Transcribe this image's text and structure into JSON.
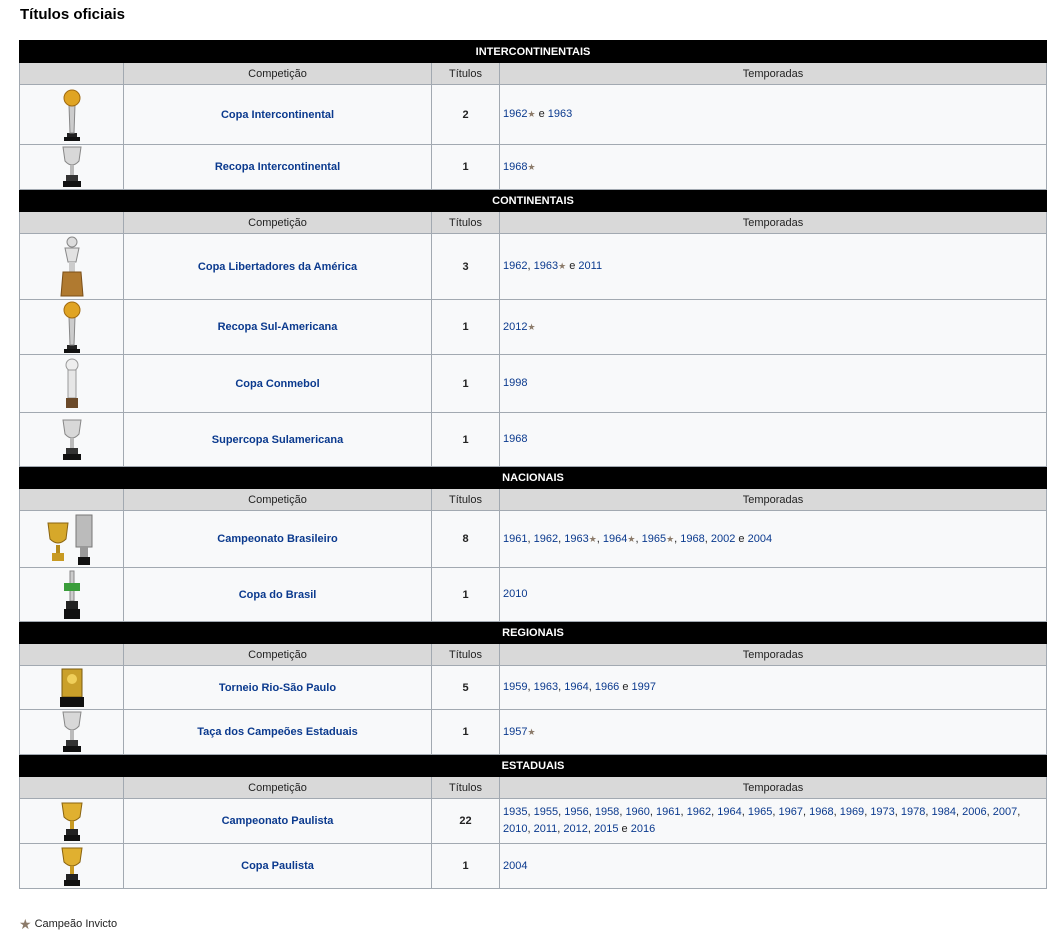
{
  "page_title": "Títulos oficiais",
  "columns": {
    "competition": "Competição",
    "titles": "Títulos",
    "seasons": "Temporadas"
  },
  "legend": {
    "text": "Campeão Invicto",
    "star_color": "#8c7b6a"
  },
  "colors": {
    "link": "#0b3a8e",
    "section_bg": "#000000",
    "header_bg": "#d9d9d9",
    "row_bg": "#f8f9fa"
  },
  "sections": [
    {
      "title": "INTERCONTINENTAIS",
      "rows": [
        {
          "name": "Copa Intercontinental",
          "titles": "2",
          "icon": "gold-ball-trophy-icon",
          "seasons": [
            {
              "y": "1962",
              "star": true,
              "sep": " e "
            },
            {
              "y": "1963",
              "star": false,
              "sep": ""
            }
          ]
        },
        {
          "name": "Recopa Intercontinental",
          "titles": "1",
          "icon": "silver-cup-trophy-icon",
          "seasons": [
            {
              "y": "1968",
              "star": true,
              "sep": ""
            }
          ]
        }
      ]
    },
    {
      "title": "CONTINENTAIS",
      "rows": [
        {
          "name": "Copa Libertadores da América",
          "titles": "3",
          "icon": "libertadores-trophy-icon",
          "seasons": [
            {
              "y": "1962",
              "star": false,
              "sep": ", "
            },
            {
              "y": "1963",
              "star": true,
              "sep": " e "
            },
            {
              "y": "2011",
              "star": false,
              "sep": ""
            }
          ]
        },
        {
          "name": "Recopa Sul-Americana",
          "titles": "1",
          "icon": "gold-ball-trophy-icon",
          "seasons": [
            {
              "y": "2012",
              "star": true,
              "sep": ""
            }
          ]
        },
        {
          "name": "Copa Conmebol",
          "titles": "1",
          "icon": "silver-pillar-trophy-icon",
          "seasons": [
            {
              "y": "1998",
              "star": false,
              "sep": ""
            }
          ]
        },
        {
          "name": "Supercopa Sulamericana",
          "titles": "1",
          "icon": "silver-cup-trophy-icon",
          "seasons": [
            {
              "y": "1968",
              "star": false,
              "sep": ""
            }
          ]
        }
      ]
    },
    {
      "title": "NACIONAIS",
      "rows": [
        {
          "name": "Campeonato Brasileiro",
          "titles": "8",
          "icon": "brasileiro-trophies-icon",
          "seasons": [
            {
              "y": "1961",
              "star": false,
              "sep": ", "
            },
            {
              "y": "1962",
              "star": false,
              "sep": ", "
            },
            {
              "y": "1963",
              "star": true,
              "sep": ", "
            },
            {
              "y": "1964",
              "star": true,
              "sep": ", "
            },
            {
              "y": "1965",
              "star": true,
              "sep": ", "
            },
            {
              "y": "1968",
              "star": false,
              "sep": ", "
            },
            {
              "y": "2002",
              "star": false,
              "sep": " e "
            },
            {
              "y": "2004",
              "star": false,
              "sep": ""
            }
          ]
        },
        {
          "name": "Copa do Brasil",
          "titles": "1",
          "icon": "copa-do-brasil-trophy-icon",
          "seasons": [
            {
              "y": "2010",
              "star": false,
              "sep": ""
            }
          ]
        }
      ]
    },
    {
      "title": "REGIONAIS",
      "rows": [
        {
          "name": "Torneio Rio-São Paulo",
          "titles": "5",
          "icon": "plaque-trophy-icon",
          "seasons": [
            {
              "y": "1959",
              "star": false,
              "sep": ", "
            },
            {
              "y": "1963",
              "star": false,
              "sep": ", "
            },
            {
              "y": "1964",
              "star": false,
              "sep": ", "
            },
            {
              "y": "1966",
              "star": false,
              "sep": " e "
            },
            {
              "y": "1997",
              "star": false,
              "sep": ""
            }
          ]
        },
        {
          "name": "Taça dos Campeões Estaduais",
          "titles": "1",
          "icon": "silver-cup-trophy-icon",
          "seasons": [
            {
              "y": "1957",
              "star": true,
              "sep": ""
            }
          ]
        }
      ]
    },
    {
      "title": "ESTADUAIS",
      "rows": [
        {
          "name": "Campeonato Paulista",
          "titles": "22",
          "icon": "gold-cup-trophy-icon",
          "seasons": [
            {
              "y": "1935",
              "star": false,
              "sep": ", "
            },
            {
              "y": "1955",
              "star": false,
              "sep": ", "
            },
            {
              "y": "1956",
              "star": false,
              "sep": ", "
            },
            {
              "y": "1958",
              "star": false,
              "sep": ", "
            },
            {
              "y": "1960",
              "star": false,
              "sep": ", "
            },
            {
              "y": "1961",
              "star": false,
              "sep": ", "
            },
            {
              "y": "1962",
              "star": false,
              "sep": ", "
            },
            {
              "y": "1964",
              "star": false,
              "sep": ", "
            },
            {
              "y": "1965",
              "star": false,
              "sep": ", "
            },
            {
              "y": "1967",
              "star": false,
              "sep": ", "
            },
            {
              "y": "1968",
              "star": false,
              "sep": ", "
            },
            {
              "y": "1969",
              "star": false,
              "sep": ", "
            },
            {
              "y": "1973",
              "star": false,
              "sep": ", "
            },
            {
              "y": "1978",
              "star": false,
              "sep": ", "
            },
            {
              "y": "1984",
              "star": false,
              "sep": ", "
            },
            {
              "y": "2006",
              "star": false,
              "sep": ", "
            },
            {
              "y": "2007",
              "star": false,
              "sep": ", "
            },
            {
              "y": "2010",
              "star": false,
              "sep": ", "
            },
            {
              "y": "2011",
              "star": false,
              "sep": ", "
            },
            {
              "y": "2012",
              "star": false,
              "sep": ", "
            },
            {
              "y": "2015",
              "star": false,
              "sep": " e "
            },
            {
              "y": "2016",
              "star": false,
              "sep": ""
            }
          ]
        },
        {
          "name": "Copa Paulista",
          "titles": "1",
          "icon": "gold-cup-trophy-icon",
          "seasons": [
            {
              "y": "2004",
              "star": false,
              "sep": ""
            }
          ]
        }
      ]
    }
  ]
}
